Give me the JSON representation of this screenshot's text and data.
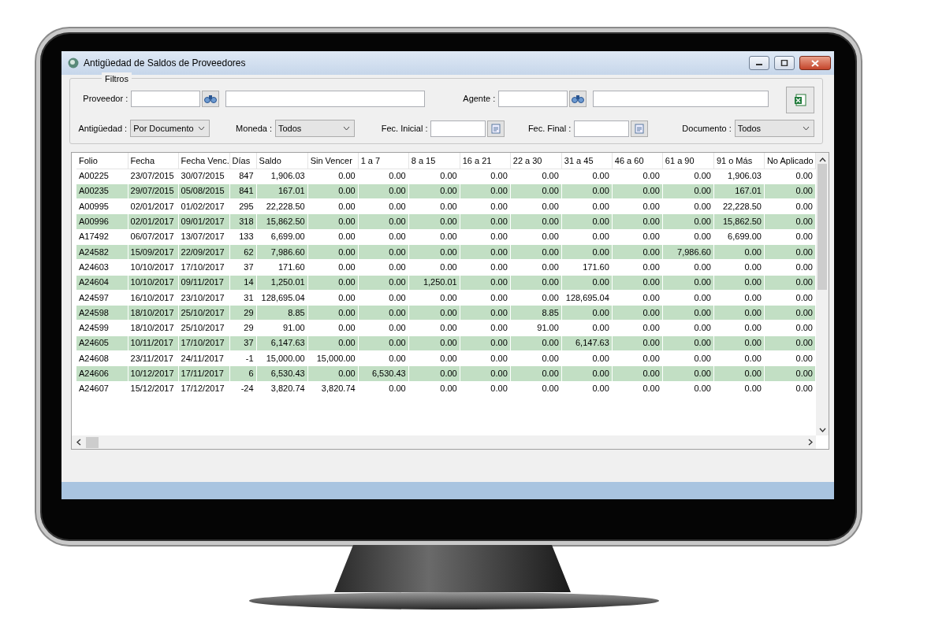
{
  "window": {
    "title": "Antigüedad de Saldos de Proveedores"
  },
  "filters": {
    "legend": "Filtros",
    "proveedor": {
      "label": "Proveedor :"
    },
    "agente": {
      "label": "Agente :"
    },
    "antiguedad": {
      "label": "Antigüedad :",
      "value": "Por Documento"
    },
    "moneda": {
      "label": "Moneda :",
      "value": "Todos"
    },
    "fec_inicial": {
      "label": "Fec. Inicial :"
    },
    "fec_final": {
      "label": "Fec. Final :"
    },
    "documento": {
      "label": "Documento :",
      "value": "Todos"
    }
  },
  "table": {
    "columns": [
      "Folio",
      "Fecha",
      "Fecha Venc.",
      "Días",
      "Saldo",
      "Sin Vencer",
      "1 a 7",
      "8 a 15",
      "16 a 21",
      "22 a 30",
      "31 a 45",
      "46 a 60",
      "61 a 90",
      "91 o Más",
      "No Aplicado"
    ],
    "rows": [
      [
        "A00225",
        "23/07/2015",
        "30/07/2015",
        "847",
        "1,906.03",
        "0.00",
        "0.00",
        "0.00",
        "0.00",
        "0.00",
        "0.00",
        "0.00",
        "0.00",
        "1,906.03",
        "0.00"
      ],
      [
        "A00235",
        "29/07/2015",
        "05/08/2015",
        "841",
        "167.01",
        "0.00",
        "0.00",
        "0.00",
        "0.00",
        "0.00",
        "0.00",
        "0.00",
        "0.00",
        "167.01",
        "0.00"
      ],
      [
        "A00995",
        "02/01/2017",
        "01/02/2017",
        "295",
        "22,228.50",
        "0.00",
        "0.00",
        "0.00",
        "0.00",
        "0.00",
        "0.00",
        "0.00",
        "0.00",
        "22,228.50",
        "0.00"
      ],
      [
        "A00996",
        "02/01/2017",
        "09/01/2017",
        "318",
        "15,862.50",
        "0.00",
        "0.00",
        "0.00",
        "0.00",
        "0.00",
        "0.00",
        "0.00",
        "0.00",
        "15,862.50",
        "0.00"
      ],
      [
        "A17492",
        "06/07/2017",
        "13/07/2017",
        "133",
        "6,699.00",
        "0.00",
        "0.00",
        "0.00",
        "0.00",
        "0.00",
        "0.00",
        "0.00",
        "0.00",
        "6,699.00",
        "0.00"
      ],
      [
        "A24582",
        "15/09/2017",
        "22/09/2017",
        "62",
        "7,986.60",
        "0.00",
        "0.00",
        "0.00",
        "0.00",
        "0.00",
        "0.00",
        "0.00",
        "7,986.60",
        "0.00",
        "0.00"
      ],
      [
        "A24603",
        "10/10/2017",
        "17/10/2017",
        "37",
        "171.60",
        "0.00",
        "0.00",
        "0.00",
        "0.00",
        "0.00",
        "171.60",
        "0.00",
        "0.00",
        "0.00",
        "0.00"
      ],
      [
        "A24604",
        "10/10/2017",
        "09/11/2017",
        "14",
        "1,250.01",
        "0.00",
        "0.00",
        "1,250.01",
        "0.00",
        "0.00",
        "0.00",
        "0.00",
        "0.00",
        "0.00",
        "0.00"
      ],
      [
        "A24597",
        "16/10/2017",
        "23/10/2017",
        "31",
        "128,695.04",
        "0.00",
        "0.00",
        "0.00",
        "0.00",
        "0.00",
        "128,695.04",
        "0.00",
        "0.00",
        "0.00",
        "0.00"
      ],
      [
        "A24598",
        "18/10/2017",
        "25/10/2017",
        "29",
        "8.85",
        "0.00",
        "0.00",
        "0.00",
        "0.00",
        "8.85",
        "0.00",
        "0.00",
        "0.00",
        "0.00",
        "0.00"
      ],
      [
        "A24599",
        "18/10/2017",
        "25/10/2017",
        "29",
        "91.00",
        "0.00",
        "0.00",
        "0.00",
        "0.00",
        "91.00",
        "0.00",
        "0.00",
        "0.00",
        "0.00",
        "0.00"
      ],
      [
        "A24605",
        "10/11/2017",
        "17/10/2017",
        "37",
        "6,147.63",
        "0.00",
        "0.00",
        "0.00",
        "0.00",
        "0.00",
        "6,147.63",
        "0.00",
        "0.00",
        "0.00",
        "0.00"
      ],
      [
        "A24608",
        "23/11/2017",
        "24/11/2017",
        "-1",
        "15,000.00",
        "15,000.00",
        "0.00",
        "0.00",
        "0.00",
        "0.00",
        "0.00",
        "0.00",
        "0.00",
        "0.00",
        "0.00"
      ],
      [
        "A24606",
        "10/12/2017",
        "17/11/2017",
        "6",
        "6,530.43",
        "0.00",
        "6,530.43",
        "0.00",
        "0.00",
        "0.00",
        "0.00",
        "0.00",
        "0.00",
        "0.00",
        "0.00"
      ],
      [
        "A24607",
        "15/12/2017",
        "17/12/2017",
        "-24",
        "3,820.74",
        "3,820.74",
        "0.00",
        "0.00",
        "0.00",
        "0.00",
        "0.00",
        "0.00",
        "0.00",
        "0.00",
        "0.00"
      ]
    ]
  }
}
